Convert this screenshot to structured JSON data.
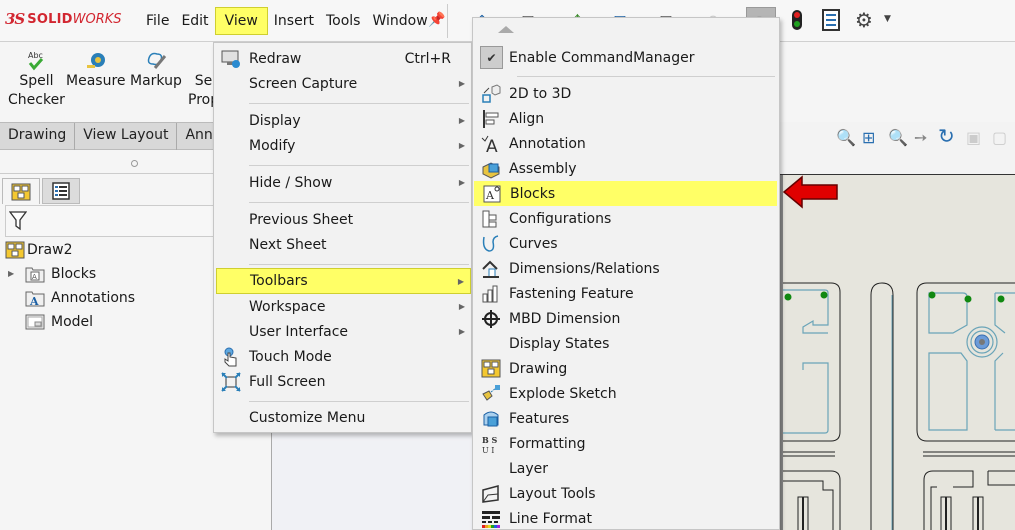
{
  "app": {
    "logo_prefix": "3S",
    "logo_bold": "SOLID",
    "logo_light": "WORKS"
  },
  "menubar": {
    "items": [
      "File",
      "Edit",
      "View",
      "Insert",
      "Tools",
      "Window"
    ],
    "active": "View"
  },
  "quick_access": {
    "icons": [
      "home-icon",
      "new-document-icon",
      "open-icon",
      "save-icon",
      "print-icon",
      "undo-icon",
      "select-icon"
    ],
    "right_icons": [
      "rebuild-icon",
      "file-properties-icon",
      "options-gear-icon"
    ]
  },
  "command_manager": {
    "buttons": [
      {
        "line1": "Spell",
        "line2": "Checker",
        "icon": "spell-checker-icon"
      },
      {
        "line1": "Measure",
        "line2": "",
        "icon": "measure-icon"
      },
      {
        "line1": "Markup",
        "line2": "",
        "icon": "markup-icon"
      },
      {
        "line1": "Se",
        "line2": "Prop",
        "icon": "sheet-properties-icon"
      }
    ],
    "tabs": [
      "Drawing",
      "View Layout",
      "Anno"
    ]
  },
  "feature_tree": {
    "root": "Draw2",
    "items": [
      {
        "label": "Blocks",
        "expandable": true
      },
      {
        "label": "Annotations",
        "expandable": false
      },
      {
        "label": "Model",
        "expandable": false
      }
    ]
  },
  "view_menu": {
    "items": [
      {
        "label": "Redraw",
        "shortcut": "Ctrl+R",
        "submenu": false,
        "icon": "redraw-icon"
      },
      {
        "label": "Screen Capture",
        "shortcut": "",
        "submenu": true,
        "icon": ""
      },
      {
        "label": "Display",
        "shortcut": "",
        "submenu": true,
        "icon": ""
      },
      {
        "label": "Modify",
        "shortcut": "",
        "submenu": true,
        "icon": ""
      },
      {
        "label": "Hide / Show",
        "shortcut": "",
        "submenu": true,
        "icon": ""
      },
      {
        "label": "Previous Sheet",
        "shortcut": "",
        "submenu": false,
        "icon": ""
      },
      {
        "label": "Next Sheet",
        "shortcut": "",
        "submenu": false,
        "icon": ""
      },
      {
        "label": "Toolbars",
        "shortcut": "",
        "submenu": true,
        "icon": "",
        "highlighted": true
      },
      {
        "label": "Workspace",
        "shortcut": "",
        "submenu": true,
        "icon": ""
      },
      {
        "label": "User Interface",
        "shortcut": "",
        "submenu": true,
        "icon": ""
      },
      {
        "label": "Touch Mode",
        "shortcut": "",
        "submenu": false,
        "icon": "touch-mode-icon"
      },
      {
        "label": "Full Screen",
        "shortcut": "",
        "submenu": false,
        "icon": "full-screen-icon"
      },
      {
        "label": "Customize Menu",
        "shortcut": "",
        "submenu": false,
        "icon": ""
      }
    ]
  },
  "toolbars_submenu": {
    "enable_command_manager": {
      "label": "Enable CommandManager",
      "checked": true
    },
    "items": [
      {
        "label": "2D to 3D",
        "icon": "2d-to-3d-icon"
      },
      {
        "label": "Align",
        "icon": "align-icon"
      },
      {
        "label": "Annotation",
        "icon": "annotation-icon"
      },
      {
        "label": "Assembly",
        "icon": "assembly-icon"
      },
      {
        "label": "Blocks",
        "icon": "blocks-icon",
        "highlighted": true
      },
      {
        "label": "Configurations",
        "icon": "configurations-icon"
      },
      {
        "label": "Curves",
        "icon": "curves-icon"
      },
      {
        "label": "Dimensions/Relations",
        "icon": "dimensions-relations-icon"
      },
      {
        "label": "Fastening Feature",
        "icon": "fastening-feature-icon"
      },
      {
        "label": "MBD Dimension",
        "icon": "mbd-dimension-icon"
      },
      {
        "label": "Display States",
        "icon": ""
      },
      {
        "label": "Drawing",
        "icon": "drawing-icon"
      },
      {
        "label": "Explode Sketch",
        "icon": "explode-sketch-icon"
      },
      {
        "label": "Features",
        "icon": "features-icon"
      },
      {
        "label": "Formatting",
        "icon": "formatting-icon"
      },
      {
        "label": "Layer",
        "icon": ""
      },
      {
        "label": "Layout Tools",
        "icon": "layout-tools-icon"
      },
      {
        "label": "Line Format",
        "icon": "line-format-icon"
      }
    ]
  },
  "view_toolbar": {
    "icons": [
      "zoom-to-fit-icon",
      "zoom-to-area-icon",
      "zoom-in-out-icon",
      "previous-view-icon",
      "rotate-icon",
      "display-style-icon",
      "hide-show-icon"
    ]
  },
  "colors": {
    "highlight": "#ffff66",
    "brand_red": "#d22630",
    "arrow_red": "#e00000",
    "sheet_bg": "#e6e5dd",
    "drawing_blue": "#6aa4b8",
    "tree_green": "#118811"
  }
}
